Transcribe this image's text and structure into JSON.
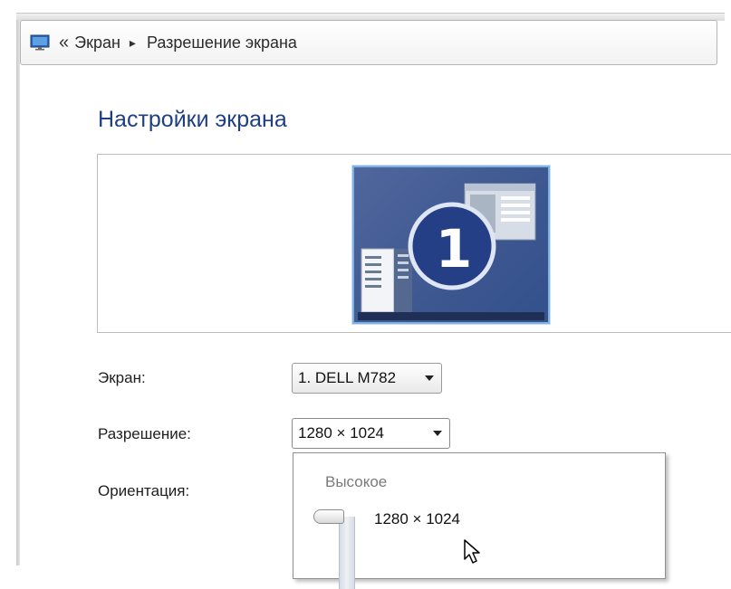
{
  "breadcrumb": {
    "back_glyph": "«",
    "items": [
      "Экран",
      "Разрешение экрана"
    ],
    "separator": "▸"
  },
  "page_title": "Настройки экрана",
  "monitor_preview": {
    "display_number": "1",
    "accent_color": "#3d5790",
    "border_color": "#7fb2e2"
  },
  "screen": {
    "label": "Экран:",
    "selected": "1. DELL M782"
  },
  "resolution": {
    "label": "Разрешение:",
    "selected": "1280 × 1024",
    "popup": {
      "high_label": "Высокое",
      "current_value": "1280 × 1024"
    }
  },
  "orientation": {
    "label": "Ориентация:"
  },
  "colors": {
    "title": "#1e3f84",
    "text": "#1e1e1e",
    "muted": "#7a7a7a"
  }
}
